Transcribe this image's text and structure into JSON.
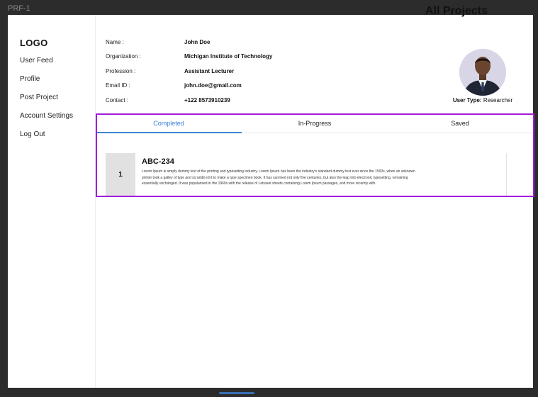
{
  "frame_label": "PRF-1",
  "overlay_title": "All Projects",
  "sidebar": {
    "logo": "LOGO",
    "items": [
      {
        "label": "User Feed"
      },
      {
        "label": "Profile"
      },
      {
        "label": "Post Project"
      },
      {
        "label": "Account Settings"
      },
      {
        "label": "Log Out"
      }
    ]
  },
  "profile": {
    "fields": [
      {
        "label": "Name :",
        "value": "John Doe"
      },
      {
        "label": "Organization :",
        "value": "Michigan Institute of Technology"
      },
      {
        "label": "Profession :",
        "value": "Assistant Lecturer"
      },
      {
        "label": "Email ID :",
        "value": "john.doe@gmail.com"
      },
      {
        "label": "Contact :",
        "value": "+122 8573910239"
      }
    ],
    "user_type_label": "User Type:",
    "user_type_value": "Researcher"
  },
  "tabs": [
    {
      "label": "Completed",
      "active": true
    },
    {
      "label": "In-Progress",
      "active": false
    },
    {
      "label": "Saved",
      "active": false
    }
  ],
  "projects": [
    {
      "number": "1",
      "title": "ABC-234",
      "description": "Lorem Ipsum is simply dummy text of the printing and typesetting industry. Lorem Ipsum has been the industry's standard dummy text ever since the 1500s, when an unknown printer took a galley of type and scrambl ed it to make a type specimen book. It has survived not only five centuries, but also the leap into electronic typesetting, remaining essentially unchanged. It was popularised in the 1960s with the release of Letraset sheets containing Lorem Ipsum passages, and more recently with"
    }
  ],
  "colors": {
    "accent": "#3b82d6",
    "selection": "#a21cdb",
    "backdrop": "#2c2c2c"
  }
}
